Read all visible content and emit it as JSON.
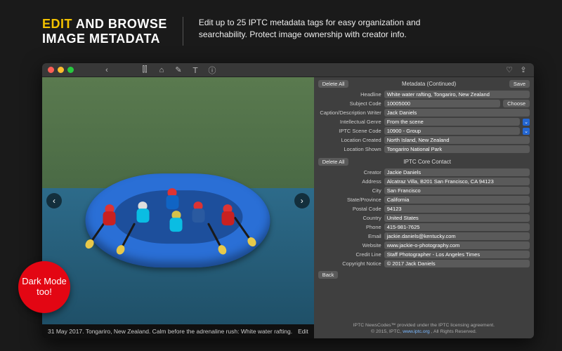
{
  "promo": {
    "title_yellow": "EDIT",
    "title_white_1": " AND BROWSE",
    "title_white_2": "IMAGE METADATA",
    "body": "Edit up to 25 IPTC metadata tags for easy organization and searchability.  Protect image ownership with creator info."
  },
  "badge": "Dark Mode too!",
  "caption": {
    "text": "31 May 2017. Tongariro, New Zealand. Calm before the adrenaline rush: White water rafting.",
    "edit": "Edit"
  },
  "panel1": {
    "delete": "Delete All",
    "title": "Metadata (Continued)",
    "save": "Save",
    "choose": "Choose",
    "rows": [
      {
        "label": "Headline",
        "value": "White water rafting, Tongariro, New Zealand"
      },
      {
        "label": "Subject Code",
        "value": "10005000"
      },
      {
        "label": "Caption/Description Writer",
        "value": "Jack Daniels"
      },
      {
        "label": "Intellectual Genre",
        "value": "From the scene"
      },
      {
        "label": "IPTC Scene Code",
        "value": "10900 - Group"
      },
      {
        "label": "Location Created",
        "value": "North Island, New Zealand"
      },
      {
        "label": "Location Shown",
        "value": "Tongariro National Park"
      }
    ]
  },
  "panel2": {
    "delete": "Delete All",
    "title": "IPTC Core Contact",
    "rows": [
      {
        "label": "Creator",
        "value": "Jackie Daniels"
      },
      {
        "label": "Address",
        "value": "Alcatraz Villa, B201 San Francisco, CA 94123"
      },
      {
        "label": "City",
        "value": "San Francisco"
      },
      {
        "label": "State/Province",
        "value": "California"
      },
      {
        "label": "Postal Code",
        "value": "94123"
      },
      {
        "label": "Country",
        "value": "United States"
      },
      {
        "label": "Phone",
        "value": "415-981-7625"
      },
      {
        "label": "Email",
        "value": "jackie.daniels@kentucky.com"
      },
      {
        "label": "Website",
        "value": "www.jackie-o-photography.com"
      },
      {
        "label": "Credit Line",
        "value": "Staff Photographer - Los Angeles Times"
      },
      {
        "label": "Copyright Notice",
        "value": "© 2017 Jack Daniels"
      }
    ],
    "back": "Back"
  },
  "credits": {
    "line1": "IPTC NewsCodes™ provided under the IPTC licensing agreement.",
    "line2_prefix": "© 2015, IPTC, ",
    "line2_link": "www.iptc.org",
    "line2_suffix": " , All Rights Reserved."
  }
}
